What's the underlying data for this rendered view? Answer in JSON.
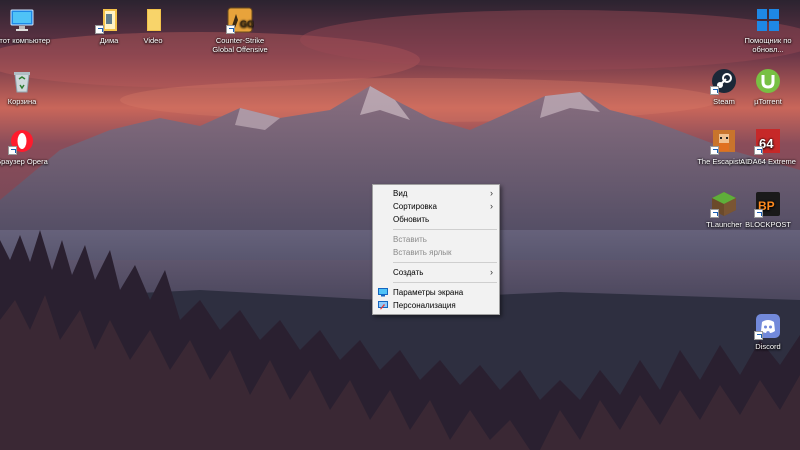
{
  "desktop": {
    "icons_left": [
      {
        "label": "Этот компьютер",
        "icon": "this-pc-icon"
      },
      {
        "label": "Корзина",
        "icon": "recycle-bin-icon"
      },
      {
        "label": "Браузер Opera",
        "icon": "opera-icon"
      }
    ],
    "icons_top": [
      {
        "label": "Дима",
        "icon": "folder-icon"
      },
      {
        "label": "Video",
        "icon": "folder-icon"
      },
      {
        "label": "Counter-Strike Global Offensive",
        "icon": "csgo-icon"
      }
    ],
    "icons_right": [
      {
        "label": "Помощник по обновл...",
        "icon": "windows-update-assistant-icon"
      },
      {
        "label": "Steam",
        "icon": "steam-icon"
      },
      {
        "label": "µTorrent",
        "icon": "utorrent-icon"
      },
      {
        "label": "The Escapists 2",
        "icon": "escapists-icon"
      },
      {
        "label": "AIDA64 Extreme",
        "icon": "aida64-icon"
      },
      {
        "label": "TLauncher",
        "icon": "tlauncher-icon"
      },
      {
        "label": "BLOCKPOST",
        "icon": "blockpost-icon"
      },
      {
        "label": "Discord",
        "icon": "discord-icon"
      }
    ]
  },
  "context_menu": {
    "items": [
      {
        "label": "Вид",
        "submenu": true,
        "disabled": false
      },
      {
        "label": "Сортировка",
        "submenu": true,
        "disabled": false
      },
      {
        "label": "Обновить",
        "submenu": false,
        "disabled": false
      },
      {
        "label": "Вставить",
        "submenu": false,
        "disabled": true
      },
      {
        "label": "Вставить ярлык",
        "submenu": false,
        "disabled": true
      },
      {
        "label": "Создать",
        "submenu": true,
        "disabled": false
      },
      {
        "label": "Параметры экрана",
        "submenu": false,
        "disabled": false,
        "icon": "display-settings-icon"
      },
      {
        "label": "Персонализация",
        "submenu": false,
        "disabled": false,
        "icon": "personalization-icon"
      }
    ]
  },
  "icons": {
    "csgo_badge": "GO",
    "aida_badge": "64",
    "blockpost_badge": "BP"
  },
  "colors": {
    "opera": "#ff1b2d",
    "steam": "#1b2838",
    "utorrent": "#78c043",
    "discord": "#7289da",
    "folder": "#f4c34a",
    "windows_blue": "#1e88e5"
  }
}
